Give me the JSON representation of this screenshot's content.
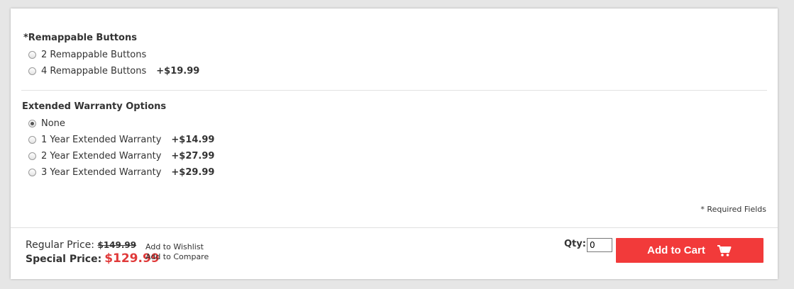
{
  "remappable": {
    "title": "*Remappable Buttons",
    "options": [
      {
        "label": "2 Remappable Buttons",
        "price": "",
        "checked": false
      },
      {
        "label": "4 Remappable Buttons",
        "price": "+$19.99",
        "checked": false
      }
    ]
  },
  "warranty": {
    "title": "Extended Warranty Options",
    "options": [
      {
        "label": "None",
        "price": "",
        "checked": true
      },
      {
        "label": "1 Year Extended Warranty",
        "price": "+$14.99",
        "checked": false
      },
      {
        "label": "2 Year Extended Warranty",
        "price": "+$27.99",
        "checked": false
      },
      {
        "label": "3 Year Extended Warranty",
        "price": "+$29.99",
        "checked": false
      }
    ]
  },
  "required_note": "* Required Fields",
  "pricing": {
    "regular_label": "Regular Price:",
    "regular_value": "$149.99",
    "special_label": "Special Price:",
    "special_value": "$129.99",
    "special_color": "#e03a3a"
  },
  "links": {
    "wishlist": "Add to Wishlist",
    "compare": "Add to Compare"
  },
  "cart": {
    "qty_label": "Qty:",
    "qty_value": "0",
    "button_label": "Add to Cart",
    "button_color": "#f23a3a",
    "icon": "shopping-cart-icon"
  }
}
